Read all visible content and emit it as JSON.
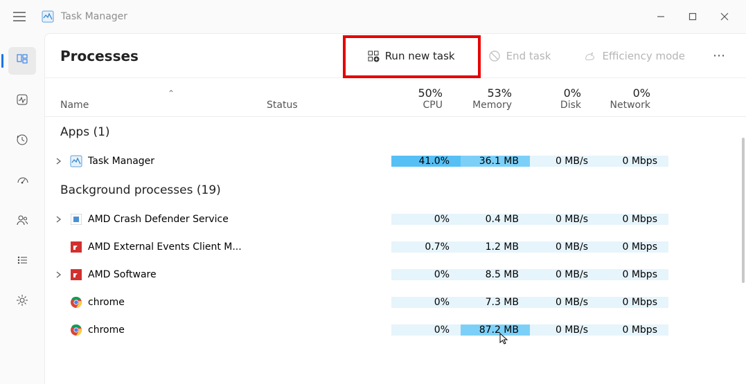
{
  "window": {
    "title": "Task Manager",
    "buttons": {
      "minimize": "—",
      "maximize": "□",
      "close": "✕"
    }
  },
  "sidebar": {
    "items": [
      {
        "id": "processes",
        "icon": "grid",
        "active": true
      },
      {
        "id": "performance",
        "icon": "pulse",
        "active": false
      },
      {
        "id": "history",
        "icon": "clock",
        "active": false
      },
      {
        "id": "startup",
        "icon": "speed",
        "active": false
      },
      {
        "id": "users",
        "icon": "people",
        "active": false
      },
      {
        "id": "details",
        "icon": "list",
        "active": false
      },
      {
        "id": "services",
        "icon": "gear",
        "active": false
      }
    ]
  },
  "toolbar": {
    "title": "Processes",
    "run_new_task": "Run new task",
    "end_task": "End task",
    "efficiency_mode": "Efficiency mode",
    "more": "⋯",
    "highlighted": "run_new_task"
  },
  "columns": {
    "name_label": "Name",
    "status_label": "Status",
    "cpu_pct": "50%",
    "cpu_label": "CPU",
    "mem_pct": "53%",
    "mem_label": "Memory",
    "disk_pct": "0%",
    "disk_label": "Disk",
    "net_pct": "0%",
    "net_label": "Network",
    "sort_indicator": "⌃"
  },
  "groups": [
    {
      "title": "Apps (1)",
      "rows": [
        {
          "expand": true,
          "icon": "taskmanager",
          "name": "Task Manager",
          "cpu": "41.0%",
          "mem": "36.1 MB",
          "disk": "0 MB/s",
          "net": "0 Mbps",
          "cpu_heat": 3,
          "mem_heat": 2,
          "disk_heat": 0,
          "net_heat": 0
        }
      ]
    },
    {
      "title": "Background processes (19)",
      "rows": [
        {
          "expand": true,
          "icon": "amd-white",
          "name": "AMD Crash Defender Service",
          "cpu": "0%",
          "mem": "0.4 MB",
          "disk": "0 MB/s",
          "net": "0 Mbps",
          "cpu_heat": 0,
          "mem_heat": 0,
          "disk_heat": 0,
          "net_heat": 0
        },
        {
          "expand": false,
          "icon": "amd-red",
          "name": "AMD External Events Client M...",
          "cpu": "0.7%",
          "mem": "1.2 MB",
          "disk": "0 MB/s",
          "net": "0 Mbps",
          "cpu_heat": 0,
          "mem_heat": 0,
          "disk_heat": 0,
          "net_heat": 0
        },
        {
          "expand": true,
          "icon": "amd-red",
          "name": "AMD Software",
          "cpu": "0%",
          "mem": "8.5 MB",
          "disk": "0 MB/s",
          "net": "0 Mbps",
          "cpu_heat": 0,
          "mem_heat": 0,
          "disk_heat": 0,
          "net_heat": 0
        },
        {
          "expand": false,
          "icon": "chrome",
          "name": "chrome",
          "cpu": "0%",
          "mem": "7.3 MB",
          "disk": "0 MB/s",
          "net": "0 Mbps",
          "cpu_heat": 0,
          "mem_heat": 0,
          "disk_heat": 0,
          "net_heat": 0
        },
        {
          "expand": false,
          "icon": "chrome",
          "name": "chrome",
          "cpu": "0%",
          "mem": "87.2 MB",
          "disk": "0 MB/s",
          "net": "0 Mbps",
          "cpu_heat": 0,
          "mem_heat": 2,
          "disk_heat": 0,
          "net_heat": 0
        }
      ]
    }
  ]
}
